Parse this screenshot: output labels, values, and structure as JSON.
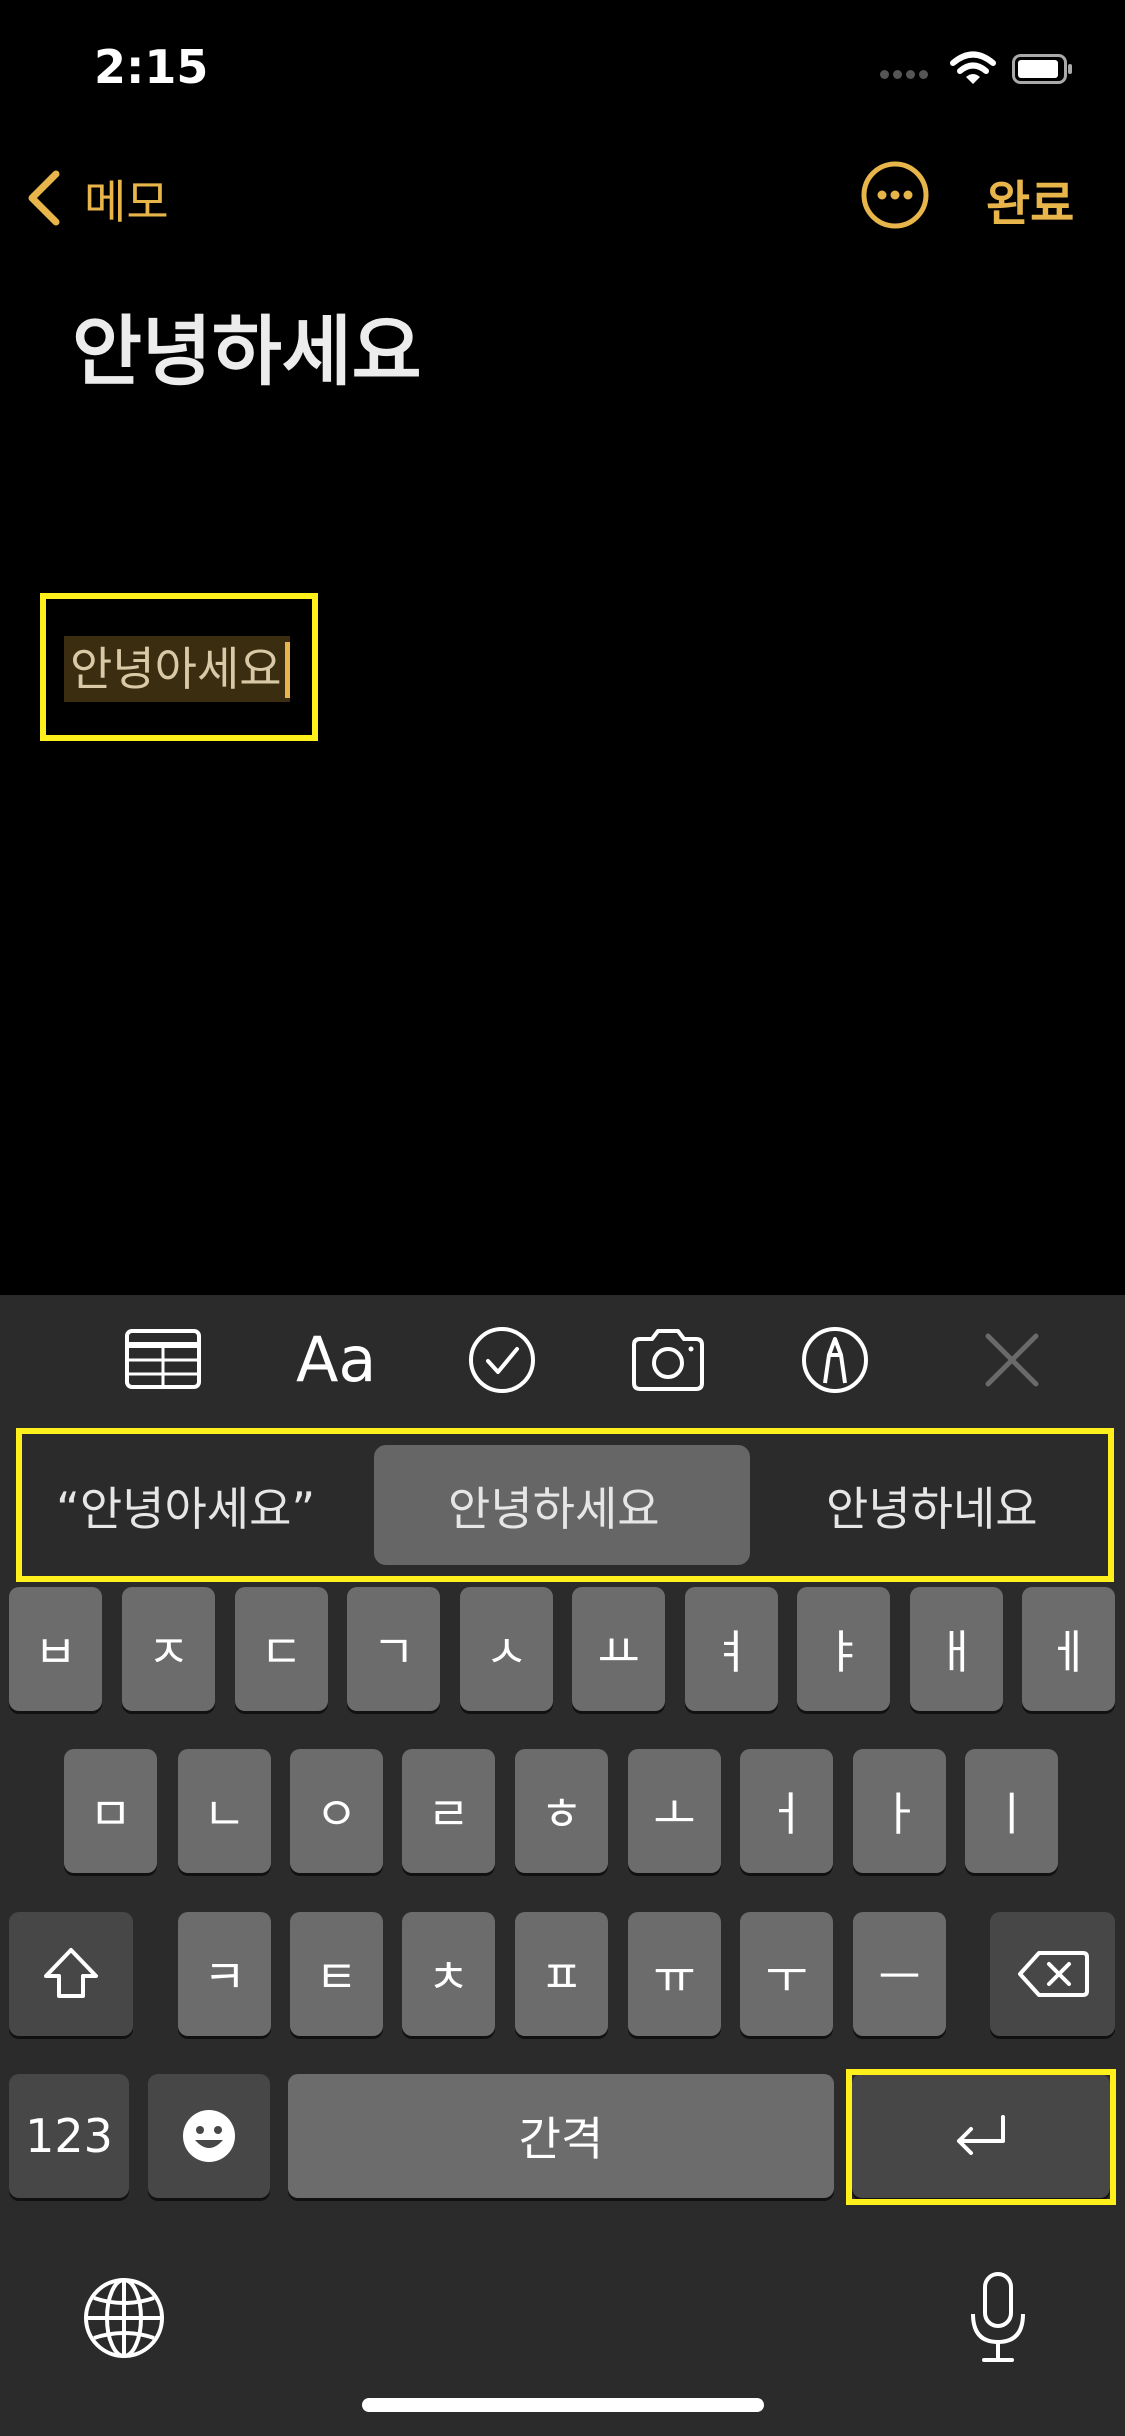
{
  "status_bar": {
    "time": "2:15"
  },
  "nav": {
    "back_label": "메모",
    "done_label": "완료"
  },
  "note": {
    "title": "안녕하세요",
    "marked_text": "안녕아세요"
  },
  "toolbar": {
    "icons": [
      "table-icon",
      "text-format-icon",
      "checklist-icon",
      "camera-icon",
      "markup-icon",
      "close-icon"
    ],
    "format_label": "Aa"
  },
  "suggestions": {
    "left": "“안녕아세요”",
    "middle": "안녕하세요",
    "right": "안녕하네요"
  },
  "keyboard": {
    "row1": [
      "ㅂ",
      "ㅈ",
      "ㄷ",
      "ㄱ",
      "ㅅ",
      "ㅛ",
      "ㅕ",
      "ㅑ",
      "ㅐ",
      "ㅔ"
    ],
    "row2": [
      "ㅁ",
      "ㄴ",
      "ㅇ",
      "ㄹ",
      "ㅎ",
      "ㅗ",
      "ㅓ",
      "ㅏ",
      "ㅣ"
    ],
    "row3": [
      "ㅋ",
      "ㅌ",
      "ㅊ",
      "ㅍ",
      "ㅠ",
      "ㅜ",
      "ㅡ"
    ],
    "numbers_label": "123",
    "space_label": "간격"
  },
  "colors": {
    "accent": "#e7b54a",
    "highlight": "#ffef1a",
    "background": "#000000",
    "keyboard_bg": "#2b2b2b"
  }
}
